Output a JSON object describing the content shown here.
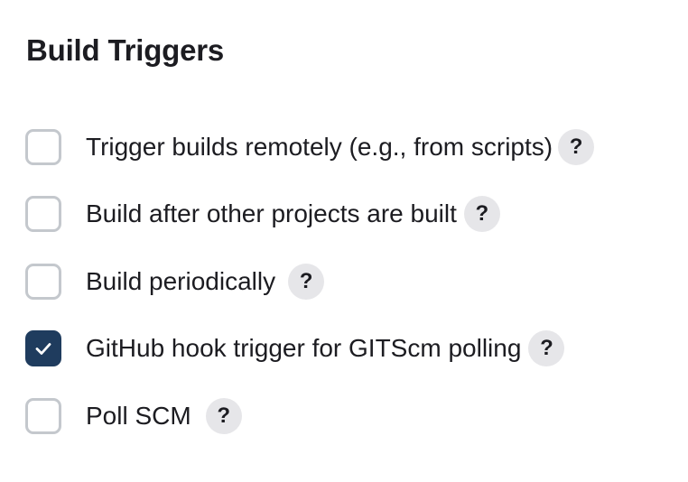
{
  "section": {
    "title": "Build Triggers"
  },
  "triggers": [
    {
      "label": "Trigger builds remotely (e.g., from scripts)",
      "checked": false,
      "help": "?"
    },
    {
      "label": "Build after other projects are built",
      "checked": false,
      "help": "?"
    },
    {
      "label": "Build periodically",
      "checked": false,
      "help": "?"
    },
    {
      "label": "GitHub hook trigger for GITScm polling",
      "checked": true,
      "help": "?"
    },
    {
      "label": "Poll SCM",
      "checked": false,
      "help": "?"
    }
  ],
  "icons": {
    "checked_mark": "checkmark-icon",
    "help": "question-mark-icon"
  },
  "colors": {
    "checked_background": "#1f3c5e",
    "unchecked_border": "#c4c8cd",
    "help_background": "#e6e6e9",
    "text": "#1c1c21"
  }
}
